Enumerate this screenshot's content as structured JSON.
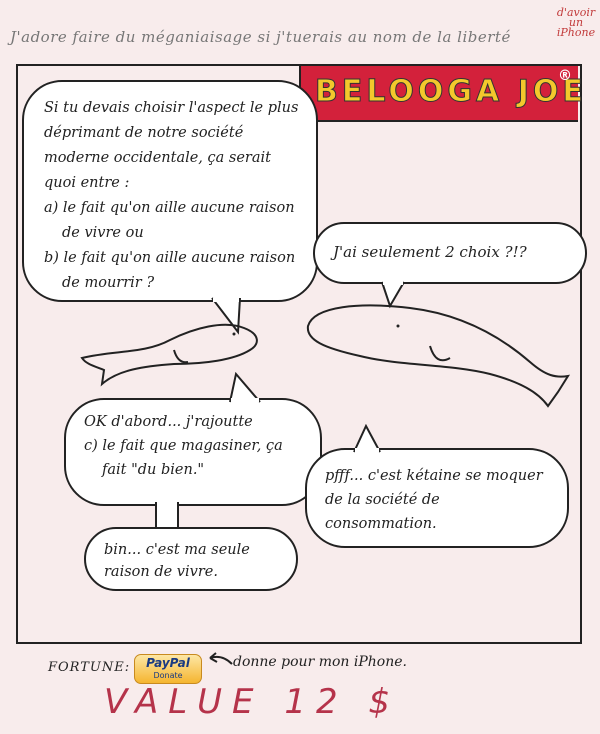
{
  "header": {
    "tagline": "J'adore faire du méganiaisage si j'tuerais au nom de la liberté",
    "iphone_note": "d'avoir un iPhone"
  },
  "logo": {
    "text": "BELOOGA JOE",
    "reg": "®"
  },
  "bubbles": {
    "question": {
      "intro": "Si tu devais choisir l'aspect le plus déprimant de notre société moderne occidentale, ça serait quoi entre :",
      "a": "a) le fait qu'on aille aucune raison de vivre ou",
      "b": "b) le fait qu'on aille aucune raison de mourrir ?"
    },
    "reply1": "J'ai seulement 2 choix ?!?",
    "addon": {
      "line1": "OK d'abord... j'rajoutte",
      "c": "c) le fait que magasiner, ça fait \"du bien.\""
    },
    "reply2": "pfff... c'est kétaine se moquer de la société de consommation.",
    "final": "bin... c'est ma seule raison de vivre."
  },
  "footer": {
    "fortune_label": "FORTUNE:",
    "paypal_text": "PayPal",
    "paypal_donate": "Donate",
    "donate_note": "donne pour mon iPhone.",
    "value": "VALUE 12 $"
  },
  "colors": {
    "logo_bg": "#d3213b",
    "logo_text": "#f3c82c",
    "value": "#b5334a",
    "paper": "#f8ecec"
  }
}
